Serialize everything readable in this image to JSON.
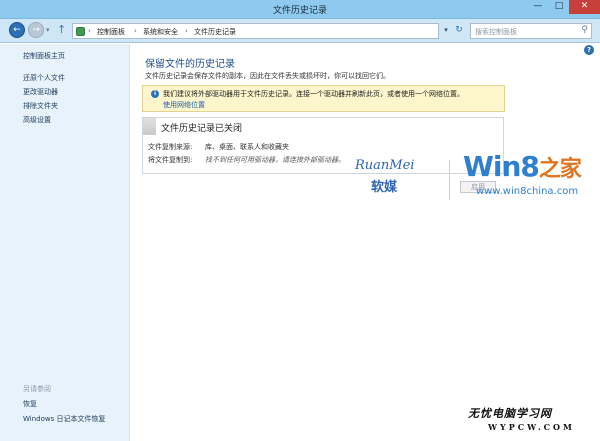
{
  "window": {
    "title": "文件历史记录",
    "min_glyph": "—",
    "max_glyph": "□",
    "close_glyph": "✕"
  },
  "nav": {
    "back_glyph": "←",
    "forward_glyph": "→",
    "recent_glyph": "▾",
    "up_glyph": "↑",
    "breadcrumb": [
      "控制面板",
      "系统和安全",
      "文件历史记录"
    ],
    "crumb_sep": "›",
    "dropdown_glyph": "▾",
    "refresh_glyph": "↻",
    "search_placeholder": "搜索控制面板",
    "search_glyph": "⚲"
  },
  "sidebar": {
    "home": "控制面板主页",
    "items": [
      "还原个人文件",
      "更改驱动器",
      "排除文件夹",
      "高级设置"
    ],
    "see_also_title": "另请参阅",
    "see_also": [
      "恢复",
      "Windows 日记本文件恢复"
    ]
  },
  "main": {
    "help_glyph": "?",
    "heading": "保留文件的历史记录",
    "description": "文件历史记录会保存文件的副本，因此在文件丢失或损坏时，你可以找回它们。",
    "info": {
      "icon_glyph": "i",
      "message": "我们建议将外部驱动器用于文件历史记录。连接一个驱动器并刷新此页，或者使用一个网络位置。",
      "link": "使用网络位置"
    },
    "status": {
      "title": "文件历史记录已关闭",
      "copy_source_label": "文件复制来源:",
      "copy_source_value": "库、桌面、联系人和收藏夹",
      "copy_to_label": "将文件复制到:",
      "copy_to_value": "找不到任何可用驱动器，请连接外部驱动器。",
      "button": "启用"
    }
  },
  "watermarks": {
    "ruanmei_en": "RuanMei",
    "ruanmei_cn": "软媒",
    "win8": "Win8",
    "win8_cn": "之家",
    "domain": "www.win8china.com",
    "bottom_cn": "无忧电脑学习网",
    "bottom_en": "WYPCW.COM"
  }
}
